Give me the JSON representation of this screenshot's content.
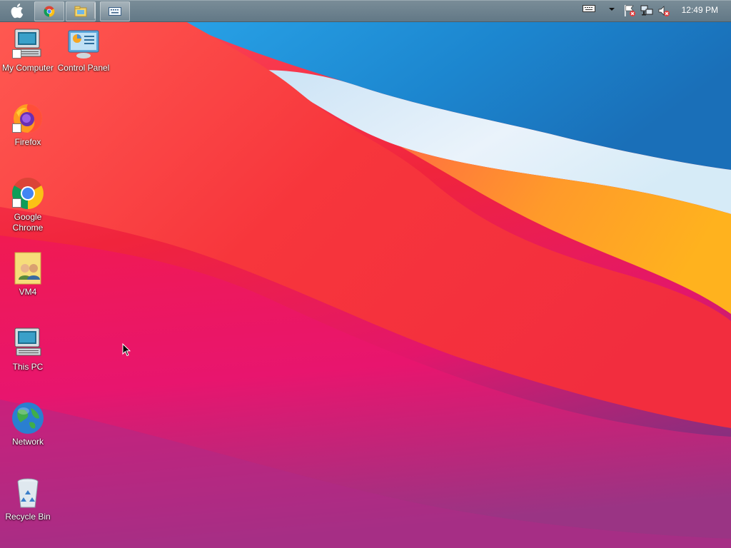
{
  "taskbar": {
    "start_icon": "apple-logo-icon",
    "pinned": [
      {
        "icon": "chrome-icon"
      },
      {
        "icon": "file-explorer-icon"
      },
      {
        "icon": "keyboard-icon"
      }
    ],
    "tray": {
      "icons": [
        "keyboard-layout-icon",
        "show-hidden-icons-chevron",
        "action-center-flag-icon",
        "network-icon",
        "volume-muted-icon"
      ],
      "clock": "12:49 PM"
    }
  },
  "desktop": {
    "icons": [
      {
        "id": "my-computer",
        "label": "My Computer",
        "icon": "computer-icon",
        "shortcut": true
      },
      {
        "id": "control-panel",
        "label": "Control Panel",
        "icon": "control-panel-icon",
        "shortcut": false
      },
      {
        "id": "firefox",
        "label": "Firefox",
        "icon": "firefox-icon",
        "shortcut": true
      },
      {
        "id": "google-chrome",
        "label": "Google Chrome",
        "icon": "chrome-icon",
        "shortcut": true
      },
      {
        "id": "vm4",
        "label": "VM4",
        "icon": "user-folder-icon",
        "shortcut": false
      },
      {
        "id": "this-pc",
        "label": "This PC",
        "icon": "computer-icon",
        "shortcut": false
      },
      {
        "id": "network",
        "label": "Network",
        "icon": "globe-icon",
        "shortcut": false
      },
      {
        "id": "recycle-bin",
        "label": "Recycle Bin",
        "icon": "recycle-bin-icon",
        "shortcut": false
      }
    ]
  },
  "colors": {
    "taskbar": "#6d808c",
    "wallpaper_red": "#f0243c",
    "wallpaper_blue": "#1e8fd8",
    "wallpaper_orange": "#ffa030",
    "wallpaper_magenta": "#d8127a"
  }
}
